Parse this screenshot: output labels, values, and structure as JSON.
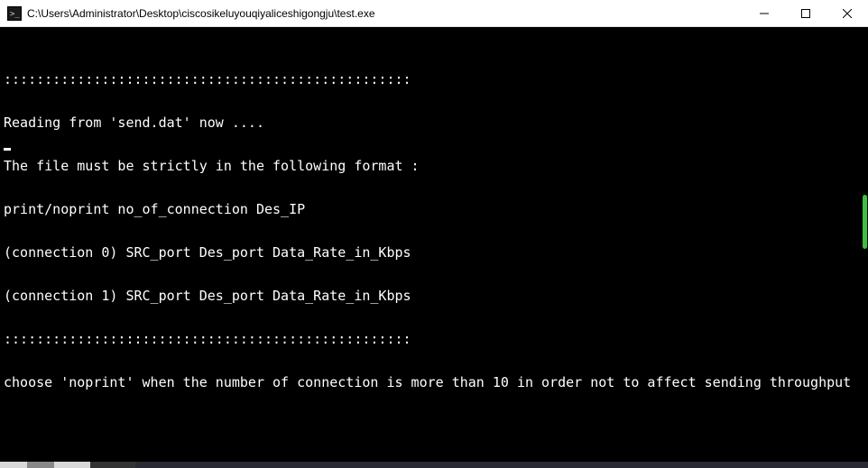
{
  "titlebar": {
    "path": "C:\\Users\\Administrator\\Desktop\\ciscosikeluyouqiyaliceshigongju\\test.exe"
  },
  "console": {
    "lines": [
      "::::::::::::::::::::::::::::::::::::::::::::::::::",
      "Reading from 'send.dat' now ....",
      "The file must be strictly in the following format :",
      "print/noprint no_of_connection Des_IP",
      "(connection 0) SRC_port Des_port Data_Rate_in_Kbps",
      "(connection 1) SRC_port Des_port Data_Rate_in_Kbps",
      "::::::::::::::::::::::::::::::::::::::::::::::::::",
      "choose 'noprint' when the number of connection is more than 10 in order not to affect sending throughput"
    ]
  },
  "watermark": {
    "text": ""
  }
}
